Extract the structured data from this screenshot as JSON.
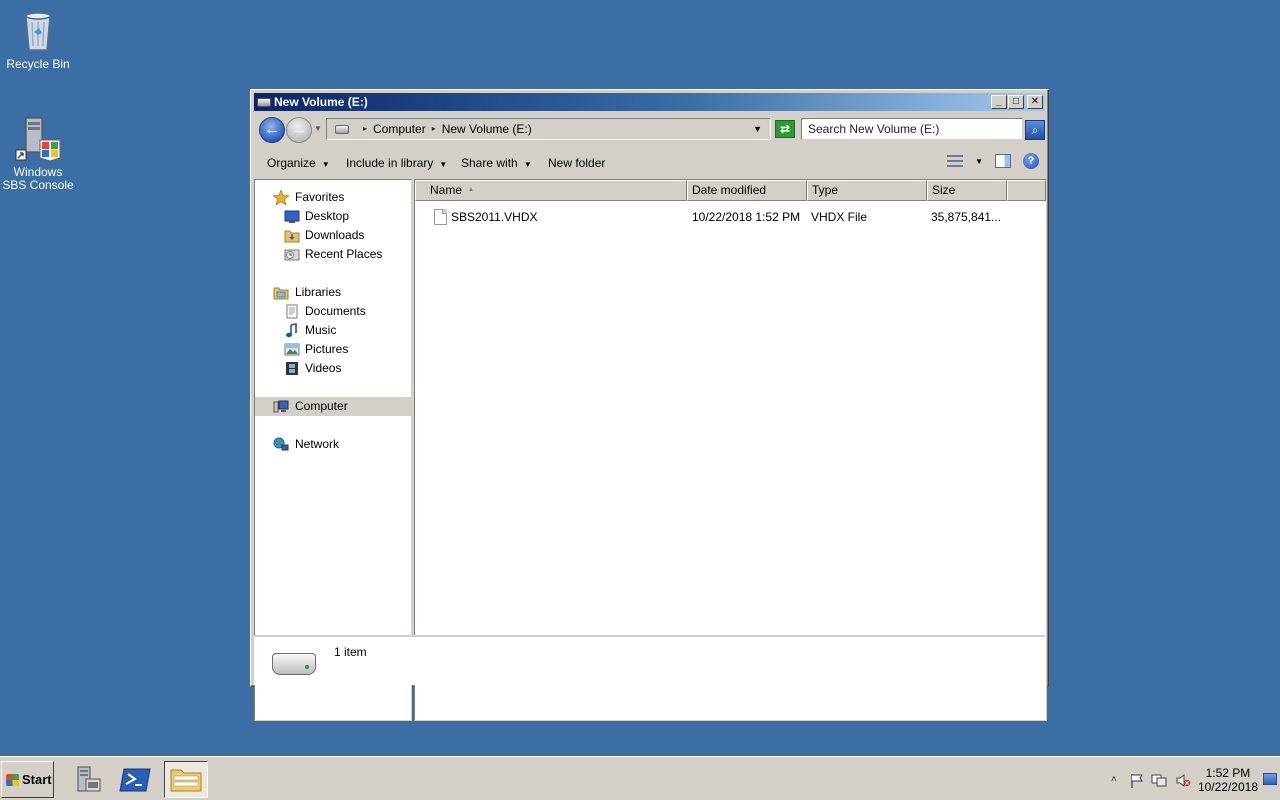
{
  "desktop": {
    "icons": [
      {
        "label": "Recycle Bin"
      },
      {
        "label": "Windows SBS Console"
      }
    ]
  },
  "window": {
    "title": "New Volume (E:)",
    "controls": {
      "minimize": "_",
      "maximize": "□",
      "close": "✕"
    }
  },
  "address": {
    "crumbs": [
      "Computer",
      "New Volume (E:)"
    ],
    "search_placeholder": "Search New Volume (E:)"
  },
  "commands": {
    "organize": "Organize",
    "include_in_library": "Include in library",
    "share_with": "Share with",
    "new_folder": "New folder"
  },
  "nav": {
    "favorites": "Favorites",
    "desktop": "Desktop",
    "downloads": "Downloads",
    "recent_places": "Recent Places",
    "libraries": "Libraries",
    "documents": "Documents",
    "music": "Music",
    "pictures": "Pictures",
    "videos": "Videos",
    "computer": "Computer",
    "network": "Network"
  },
  "table": {
    "columns": [
      "Name",
      "Date modified",
      "Type",
      "Size"
    ],
    "rows": [
      {
        "name": "SBS2011.VHDX",
        "date": "10/22/2018 1:52 PM",
        "type": "VHDX File",
        "size": "35,875,841..."
      }
    ]
  },
  "details": {
    "count": "1 item"
  },
  "taskbar": {
    "start": "Start",
    "time": "1:52 PM",
    "date": "10/22/2018"
  }
}
